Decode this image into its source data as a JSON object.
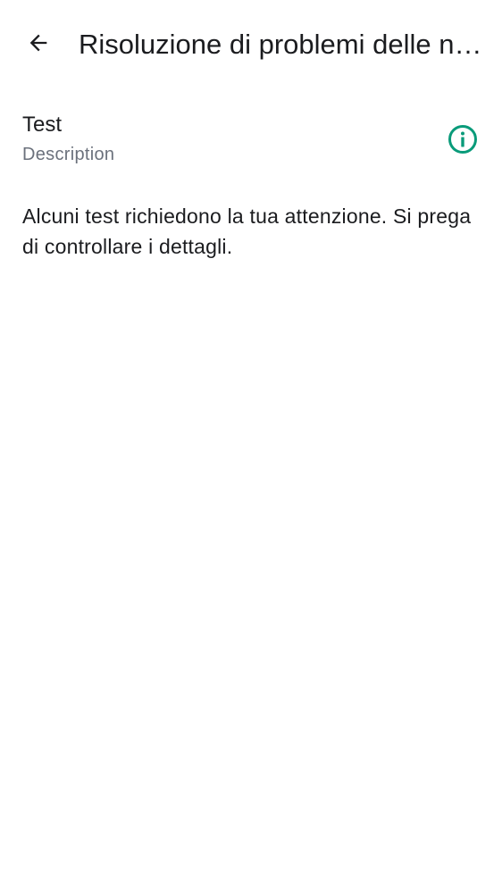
{
  "header": {
    "back_icon": "arrow-back-icon",
    "title": "Risoluzione di problemi delle notifiche"
  },
  "test_item": {
    "title": "Test",
    "description": "Description",
    "status_icon": "info-icon",
    "status_color": "#0a9b7a"
  },
  "message": "Alcuni test richiedono la tua attenzione. Si prega di controllare i dettagli."
}
